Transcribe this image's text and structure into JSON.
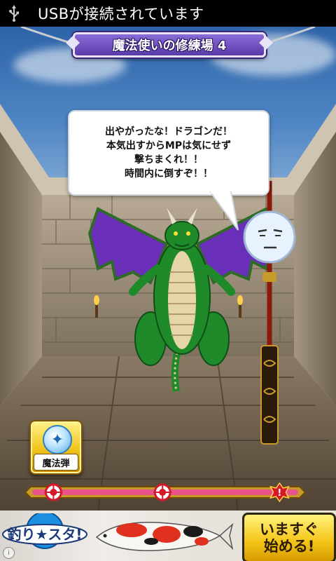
{
  "status_bar": {
    "notification": "USBが接続されています",
    "icon": "usb-icon"
  },
  "stage": {
    "title": "魔法使いの修練場 4"
  },
  "speech_bubble": {
    "lines": [
      "出やがったな！ドラゴンだ！",
      "本気出すからMPは気にせず",
      "撃ちまくれ！！",
      "時間内に倒すぞ！！"
    ]
  },
  "skill_button": {
    "label": "魔法弾",
    "icon": "sparkle-orb-icon"
  },
  "progress": {
    "checkpoints": [
      0.08,
      0.49
    ],
    "goal": 0.93,
    "icons": [
      "target-marker-icon",
      "alert-marker-icon"
    ]
  },
  "ad": {
    "logo_text": "釣り★スタ!",
    "cta_line1": "いますぐ",
    "cta_line2": "始める!",
    "info_icon": "info-icon"
  },
  "colors": {
    "banner_purple": "#6a4cc0",
    "dragon_green": "#1f8a2a",
    "wing_purple": "#7a2ad0",
    "button_gold": "#f0c21a",
    "progress_pink": "#e8548a",
    "marker_red": "#d41a2a"
  }
}
